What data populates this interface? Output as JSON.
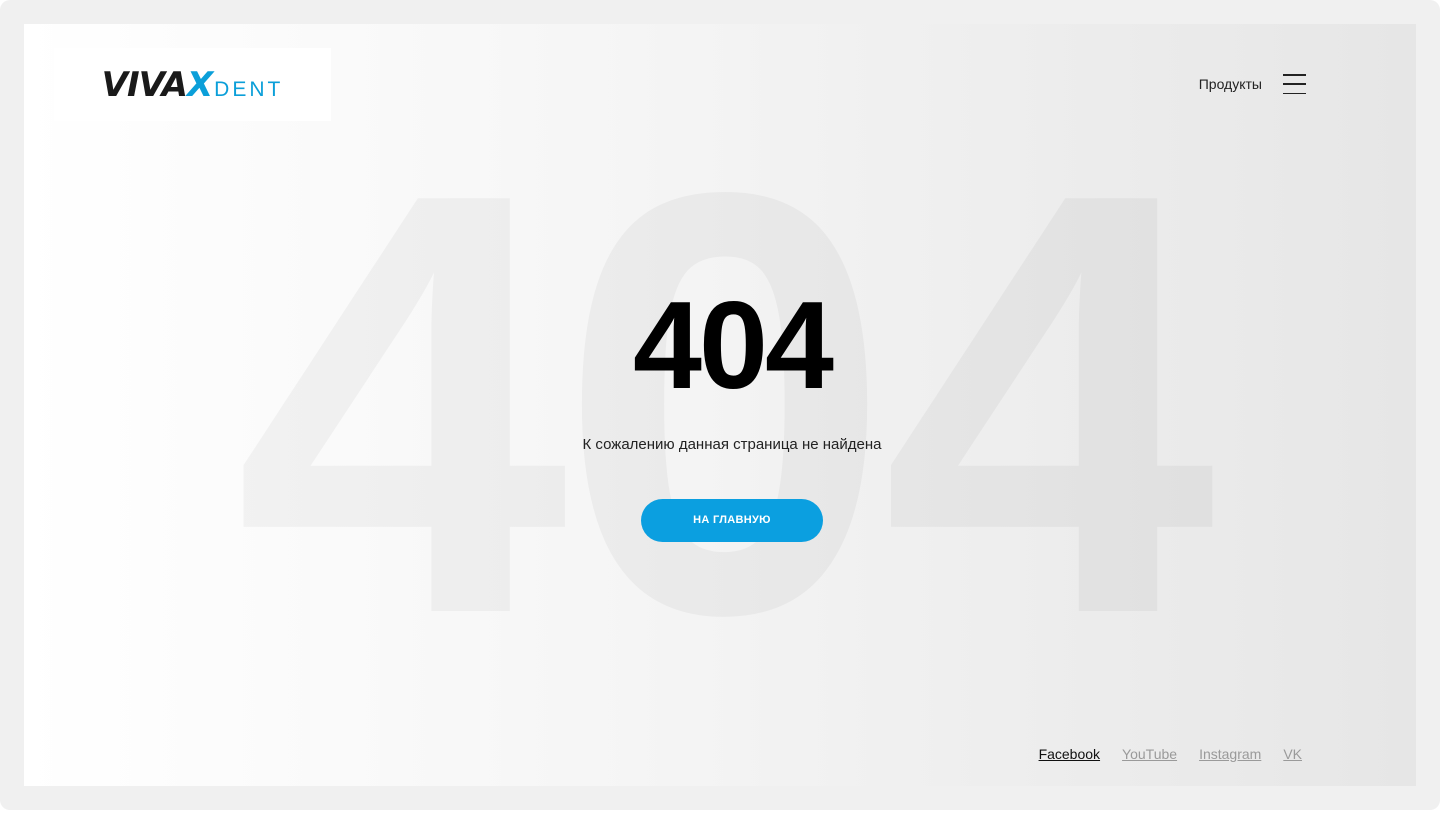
{
  "logo": {
    "vivax_part1": "VIVA",
    "vivax_part2": "X",
    "dent": "DENT"
  },
  "header": {
    "nav_label": "Продукты",
    "menu_icon": "hamburger-icon"
  },
  "background_text": "404",
  "error": {
    "code": "404",
    "message": "К сожалению данная страница не найдена",
    "button_label": "НА ГЛАВНУЮ"
  },
  "social": {
    "facebook": "Facebook",
    "youtube": "YouTube",
    "instagram": "Instagram",
    "vk": "VK"
  },
  "colors": {
    "accent": "#0b9fe0",
    "text": "#222222",
    "muted_link": "#9a9a9a"
  }
}
